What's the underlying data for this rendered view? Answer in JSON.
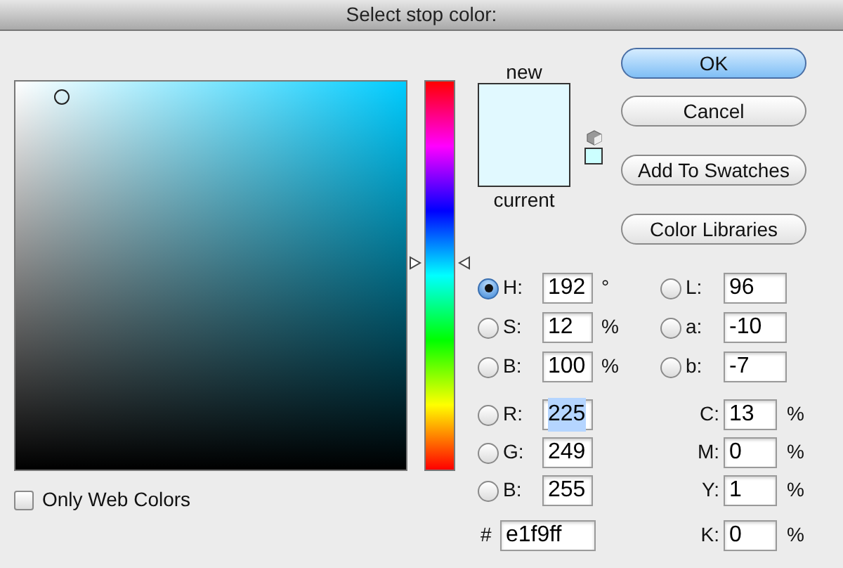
{
  "window": {
    "title": "Select stop color:"
  },
  "color_field": {
    "only_web_colors": {
      "label": "Only Web Colors",
      "checked": false
    }
  },
  "hue_slider": {
    "level": 0.467
  },
  "preview": {
    "new_label": "new",
    "current_label": "current"
  },
  "buttons": [
    {
      "label": "OK",
      "kind": "default"
    },
    {
      "label": "Cancel",
      "kind": "normal"
    },
    {
      "label": "Add To Swatches",
      "kind": "normal"
    },
    {
      "label": "Color Libraries",
      "kind": "normal"
    }
  ],
  "hsb": [
    {
      "label": "H:",
      "value": "192",
      "unit": "°",
      "selected": true,
      "highlighted": false
    },
    {
      "label": "S:",
      "value": "12",
      "unit": "%",
      "selected": false,
      "highlighted": false
    },
    {
      "label": "B:",
      "value": "100",
      "unit": "%",
      "selected": false,
      "highlighted": false
    }
  ],
  "lab": [
    {
      "label": "L:",
      "value": "96",
      "selected": false,
      "highlighted": false
    },
    {
      "label": "a:",
      "value": "-10",
      "selected": false,
      "highlighted": false
    },
    {
      "label": "b:",
      "value": "-7",
      "selected": false,
      "highlighted": false
    }
  ],
  "rgb": [
    {
      "label": "R:",
      "value": "225",
      "selected": false,
      "highlighted": true
    },
    {
      "label": "G:",
      "value": "249",
      "selected": false,
      "highlighted": false
    },
    {
      "label": "B:",
      "value": "255",
      "selected": false,
      "highlighted": false
    }
  ],
  "cmyk": [
    {
      "label": "C:",
      "value": "13",
      "unit": "%",
      "highlighted": false
    },
    {
      "label": "M:",
      "value": "0",
      "unit": "%",
      "highlighted": false
    },
    {
      "label": "Y:",
      "value": "1",
      "unit": "%",
      "highlighted": false
    },
    {
      "label": "K:",
      "value": "0",
      "unit": "%",
      "highlighted": false
    }
  ],
  "hex": {
    "label": "#",
    "value": "e1f9ff",
    "highlighted": false
  }
}
